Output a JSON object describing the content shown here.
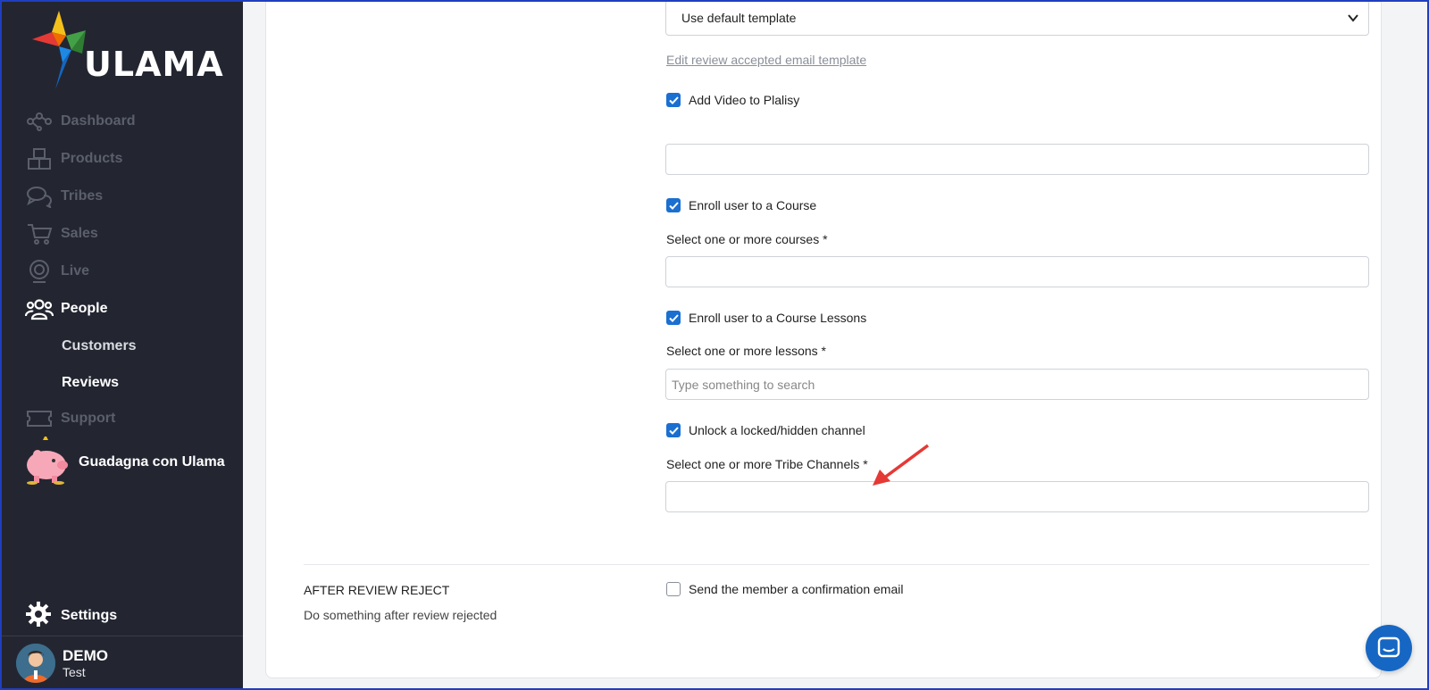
{
  "brand": {
    "logo_text": "ULAMA"
  },
  "sidebar": {
    "items": [
      {
        "label": "Dashboard",
        "icon": "network-icon"
      },
      {
        "label": "Products",
        "icon": "boxes-icon"
      },
      {
        "label": "Tribes",
        "icon": "chat-bubbles-icon"
      },
      {
        "label": "Sales",
        "icon": "cart-icon"
      },
      {
        "label": "Live",
        "icon": "webcam-icon"
      },
      {
        "label": "People",
        "icon": "people-icon"
      }
    ],
    "people_sub": [
      "Customers",
      "Reviews"
    ],
    "support": {
      "label": "Support",
      "icon": "ticket-icon"
    },
    "promo": {
      "label": "Guadagna con Ulama",
      "icon": "piggy-bank-icon"
    },
    "settings": {
      "label": "Settings",
      "icon": "gear-icon"
    },
    "user": {
      "name": "DEMO",
      "sub": "Test"
    }
  },
  "form": {
    "template_select": "Use default template",
    "edit_link": "Edit review accepted email template",
    "add_video": {
      "label": "Add Video to Plalisy",
      "checked": true,
      "value": ""
    },
    "enroll_course": {
      "label": "Enroll user to a Course",
      "checked": true,
      "field_label": "Select one or more courses *",
      "value": ""
    },
    "enroll_lessons": {
      "label": "Enroll user to a Course Lessons",
      "checked": true,
      "field_label": "Select one or more lessons *",
      "placeholder": "Type something to search"
    },
    "unlock_channel": {
      "label": "Unlock a locked/hidden channel",
      "checked": true,
      "field_label": "Select one or more Tribe Channels *",
      "value": ""
    }
  },
  "reject_section": {
    "title": "AFTER REVIEW REJECT",
    "description": "Do something after review rejected",
    "confirm_email": {
      "label": "Send the member a confirmation email",
      "checked": false
    }
  },
  "colors": {
    "sidebar_bg": "#232631",
    "accent": "#1a6fd1",
    "arrow": "#e53935"
  }
}
